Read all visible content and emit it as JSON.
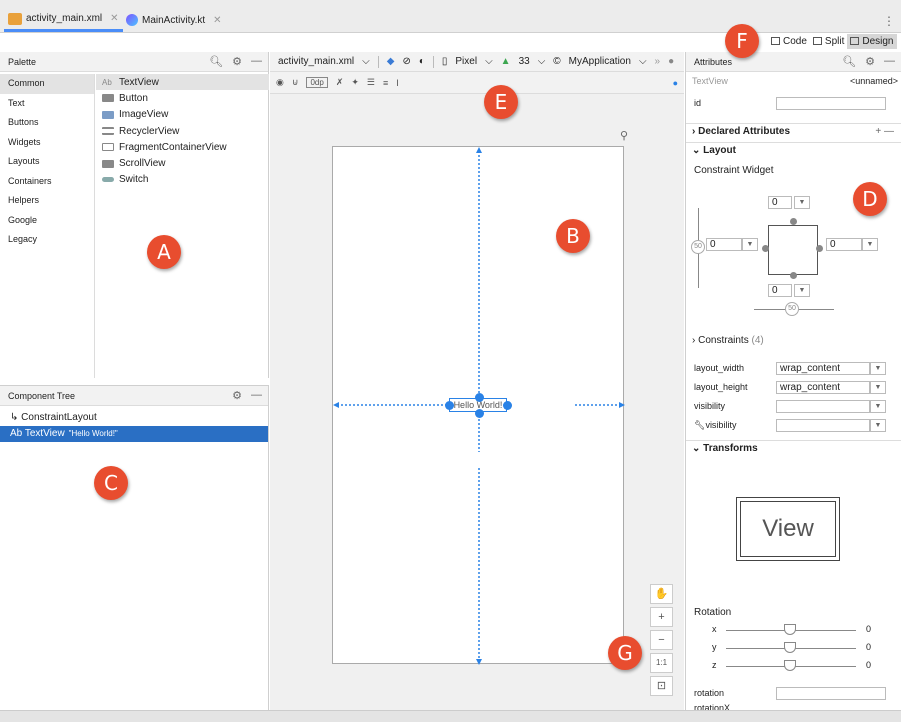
{
  "tabs": [
    {
      "label": "activity_main.xml",
      "active": true
    },
    {
      "label": "MainActivity.kt",
      "active": false
    }
  ],
  "modes": [
    {
      "label": "Code",
      "active": false
    },
    {
      "label": "Split",
      "active": false
    },
    {
      "label": "Design",
      "active": true
    }
  ],
  "palette": {
    "title": "Palette",
    "categories": [
      "Common",
      "Text",
      "Buttons",
      "Widgets",
      "Layouts",
      "Containers",
      "Helpers",
      "Google",
      "Legacy"
    ],
    "selected_category": "Common",
    "items": [
      "TextView",
      "Button",
      "ImageView",
      "RecyclerView",
      "FragmentContainerView",
      "ScrollView",
      "Switch"
    ],
    "ab_prefix": "Ab"
  },
  "component_tree": {
    "title": "Component Tree",
    "rows": [
      {
        "label": "ConstraintLayout",
        "sub": ""
      },
      {
        "label": "Ab TextView",
        "sub": "\"Hello World!\""
      }
    ]
  },
  "editor": {
    "file": "activity_main.xml",
    "device": "Pixel",
    "api": "33",
    "theme": "MyApplication",
    "margin": "0dp",
    "textview_text": "Hello World!"
  },
  "attributes": {
    "title": "Attributes",
    "widget_type": "TextView",
    "widget_name": "<unnamed>",
    "id_label": "id",
    "declared_label": "Declared Attributes",
    "layout_label": "Layout",
    "constraint_widget_label": "Constraint Widget",
    "margins": {
      "top": "0",
      "bottom": "0",
      "left": "0",
      "right": "0"
    },
    "bias": {
      "vertical": "50",
      "horizontal": "50"
    },
    "constraints_label": "Constraints",
    "constraints_count": "(4)",
    "props": [
      {
        "name": "layout_width",
        "value": "wrap_content"
      },
      {
        "name": "layout_height",
        "value": "wrap_content"
      },
      {
        "name": "visibility",
        "value": ""
      },
      {
        "name": "visibility",
        "value": ""
      }
    ],
    "transforms_label": "Transforms",
    "view_preview": "View",
    "rotation_label": "Rotation",
    "rotation_axes": [
      {
        "axis": "x",
        "value": "0"
      },
      {
        "axis": "y",
        "value": "0"
      },
      {
        "axis": "z",
        "value": "0"
      }
    ],
    "rotation_props": [
      "rotation",
      "rotationX"
    ]
  },
  "zoom": [
    "+",
    "−",
    "1:1"
  ],
  "callouts": [
    "A",
    "B",
    "C",
    "D",
    "E",
    "F",
    "G"
  ],
  "colors": {
    "accent": "#2a82e6",
    "selection": "#2a6fc4",
    "callout": "#e84d2f"
  }
}
